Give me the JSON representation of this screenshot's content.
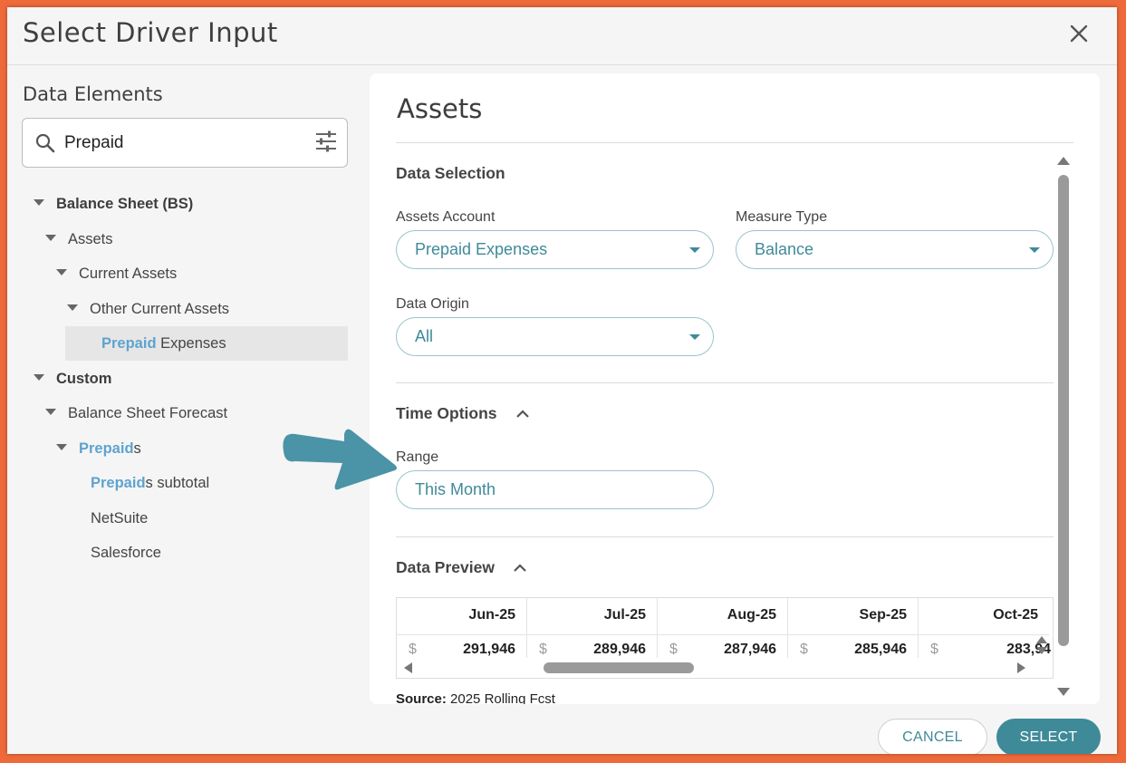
{
  "dialog": {
    "title": "Select Driver Input"
  },
  "left_panel": {
    "heading": "Data Elements",
    "search": {
      "value": "Prepaid",
      "placeholder": ""
    },
    "tree": [
      {
        "label": "Balance Sheet (BS)",
        "hl": "",
        "rest": "Balance Sheet (BS)",
        "level": 0,
        "bold": true
      },
      {
        "label": "Assets",
        "hl": "",
        "rest": "Assets",
        "level": 1
      },
      {
        "label": "Current Assets",
        "hl": "",
        "rest": "Current Assets",
        "level": 2
      },
      {
        "label": "Other Current Assets",
        "hl": "",
        "rest": "Other Current Assets",
        "level": 3
      },
      {
        "label": "Prepaid Expenses",
        "hl": "Prepaid",
        "rest": " Expenses",
        "level": 4,
        "selected": true
      },
      {
        "label": "Custom",
        "hl": "",
        "rest": "Custom",
        "level": 0,
        "bold": true
      },
      {
        "label": "Balance Sheet Forecast",
        "hl": "",
        "rest": "Balance Sheet Forecast",
        "level": 1
      },
      {
        "label": "Prepaids",
        "hl": "Prepaid",
        "rest": "s",
        "level": 2
      },
      {
        "label": "Prepaids subtotal",
        "hl": "Prepaid",
        "rest": "s subtotal",
        "level": 3
      },
      {
        "label": "NetSuite",
        "hl": "",
        "rest": "NetSuite",
        "level": 3
      },
      {
        "label": "Salesforce",
        "hl": "",
        "rest": "Salesforce",
        "level": 3
      }
    ]
  },
  "right_panel": {
    "title": "Assets",
    "data_selection": {
      "title": "Data Selection",
      "assets_account_label": "Assets Account",
      "assets_account_value": "Prepaid Expenses",
      "measure_type_label": "Measure Type",
      "measure_type_value": "Balance",
      "data_origin_label": "Data Origin",
      "data_origin_value": "All"
    },
    "time_options": {
      "title": "Time Options",
      "range_label": "Range",
      "range_value": "This Month"
    },
    "data_preview": {
      "title": "Data Preview",
      "currency_symbol": "$",
      "columns": [
        {
          "month": "Jun-25",
          "value": "291,946"
        },
        {
          "month": "Jul-25",
          "value": "289,946"
        },
        {
          "month": "Aug-25",
          "value": "287,946"
        },
        {
          "month": "Sep-25",
          "value": "285,946"
        },
        {
          "month": "Oct-25",
          "value": "283,94"
        }
      ],
      "source_label": "Source:",
      "source_value": "2025 Rolling Fcst"
    }
  },
  "footer": {
    "cancel_label": "CANCEL",
    "select_label": "SELECT"
  },
  "colors": {
    "accent": "#3f8a99",
    "highlight": "#5fa3cf",
    "frame": "#ee6a3a",
    "annotation_arrow": "#4b93a6"
  },
  "icons": {
    "close": "close-icon",
    "search": "search-icon",
    "filter": "filter-sliders-icon"
  }
}
